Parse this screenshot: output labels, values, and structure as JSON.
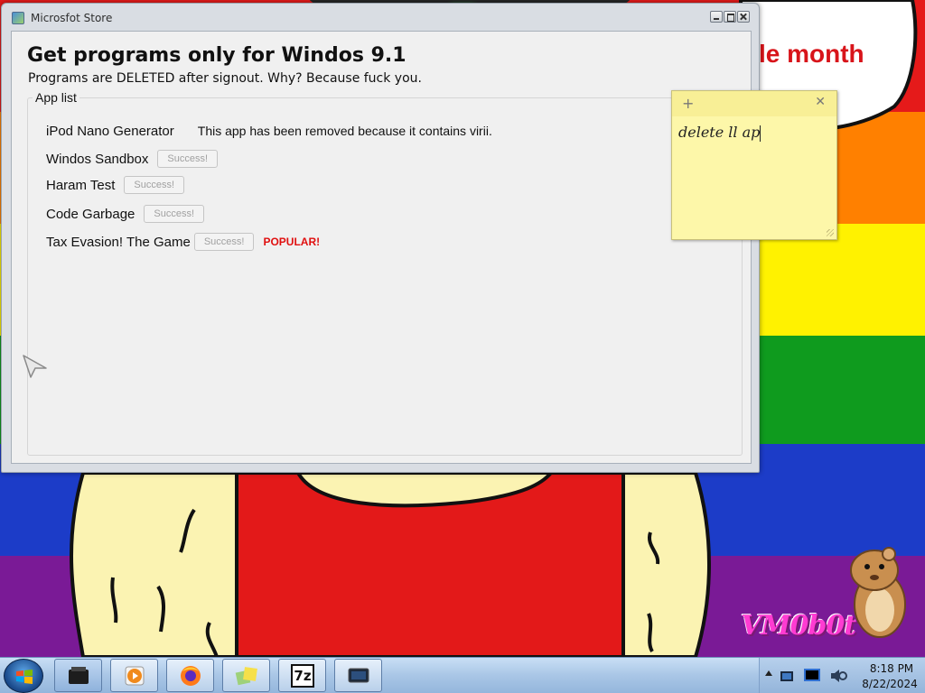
{
  "desktop": {
    "banner_text": "le month",
    "watermark": "VM0b0t",
    "rainbow_colors": [
      "#e51a1a",
      "#ff8000",
      "#fff200",
      "#0f9b1e",
      "#1c3cc8",
      "#7a1a96"
    ],
    "shirt_color": "#e31919",
    "skin_color": "#fbf3b2"
  },
  "window": {
    "title": "Microsfot Store",
    "heading": "Get programs only for Windos 9.1",
    "subheading": "Programs are DELETED after signout. Why? Because fuck you.",
    "group_label": "App list",
    "apps": [
      {
        "name": "iPod Nano Generator",
        "note": "This app has been removed because it contains virii."
      },
      {
        "name": "Windos Sandbox",
        "button": "Success!"
      },
      {
        "name": "Haram Test",
        "button": "Success!"
      },
      {
        "name": "Code Garbage",
        "button": "Success!"
      },
      {
        "name": "Tax Evasion! The Game",
        "button": "Success!",
        "badge": "POPULAR!"
      }
    ]
  },
  "sticky_note": {
    "add_symbol": "+",
    "close_symbol": "✕",
    "text": "delete ll ap"
  },
  "taskbar": {
    "items": [
      "devices-icon",
      "media-player-icon",
      "firefox-icon",
      "photos-icon",
      "7zip-icon",
      "screen-icon"
    ],
    "seven_zip_label": "7z",
    "clock": {
      "time": "8:18 PM",
      "date": "8/22/2024"
    }
  }
}
